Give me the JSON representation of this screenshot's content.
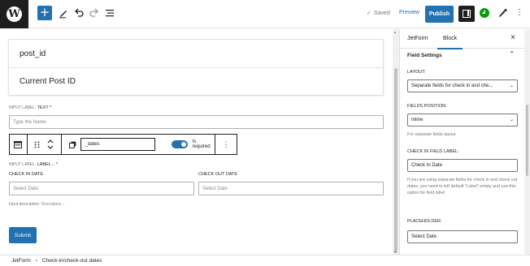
{
  "topbar": {
    "logo_letter": "W",
    "add_label": "+",
    "saved_label": "Saved",
    "preview_label": "Preview",
    "publish_label": "Publish",
    "kebab_label": "⋮",
    "accent_color": "#2271b1"
  },
  "canvas": {
    "card_rows": [
      "post_id",
      "Current Post ID"
    ],
    "text_field": {
      "label_prefix": "INPUT LABEL:",
      "label_value": "TEXT *",
      "placeholder": "Type the Name"
    },
    "block_toolbar": {
      "name_value": "_dates",
      "required_label": "Is required",
      "required_on": true
    },
    "date_field": {
      "label_prefix": "INPUT LABEL:",
      "label_value": "LABEL... *",
      "check_in_label": "CHECK IN DATE",
      "check_out_label": "CHECK OUT DATE",
      "check_in_placeholder": "Select Date",
      "check_out_placeholder": "Select Date",
      "description_prefix": "Input description:",
      "description_value": "Description..."
    },
    "submit_label": "Submit"
  },
  "sidebar": {
    "tabs": [
      "JetForm",
      "Block"
    ],
    "active_tab": "Block",
    "close_label": "×",
    "section_title": "Field Settings",
    "layout_label": "LAYOUT:",
    "layout_value": "Separate fields for check in and che...",
    "fields_position_label": "FIELDS POSITION:",
    "fields_position_value": "Inline",
    "fields_position_help": "For separate fields layout",
    "check_in_field_label": "CHECK IN FIELD LABEL:",
    "check_in_field_value": "Check In Date",
    "check_in_help": "If you are using separate fields for check in and check out dates, you need to left default \"Label\" empty and use this option for field label",
    "placeholder_label": "PLACEHOLDER:",
    "placeholder_value": "Select Date"
  },
  "footer": {
    "breadcrumb": [
      "JetForm",
      "Check-in/check-out dates"
    ],
    "separator": "›"
  }
}
